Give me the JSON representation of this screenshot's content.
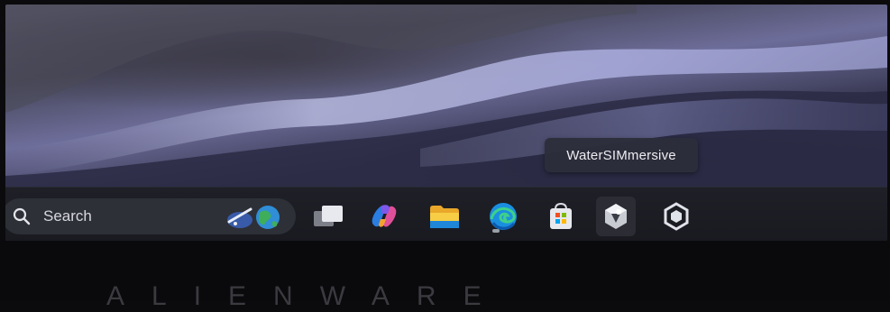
{
  "tooltip": {
    "text": "WaterSIMmersive"
  },
  "taskbar": {
    "search": {
      "label": "Search",
      "icon": "search-icon",
      "highlight_icon": "search-highlight-icon"
    },
    "apps": [
      {
        "name": "task-view",
        "icon": "task-view-icon"
      },
      {
        "name": "copilot",
        "icon": "copilot-icon"
      },
      {
        "name": "file-explorer",
        "icon": "folder-icon"
      },
      {
        "name": "edge",
        "icon": "edge-icon",
        "running": true
      },
      {
        "name": "microsoft-store",
        "icon": "store-icon"
      },
      {
        "name": "watersimmersive",
        "icon": "watersim-icon",
        "hovered": true
      },
      {
        "name": "app-7",
        "icon": "cube-icon"
      }
    ]
  },
  "bezel": {
    "logo_text": "ALIENWARE"
  },
  "colors": {
    "taskbar": "#1c1d23",
    "search": "#2e3038",
    "tooltip": "#2c2d3a",
    "edge": "#1a8fe0",
    "folder": "#f4c43a"
  }
}
